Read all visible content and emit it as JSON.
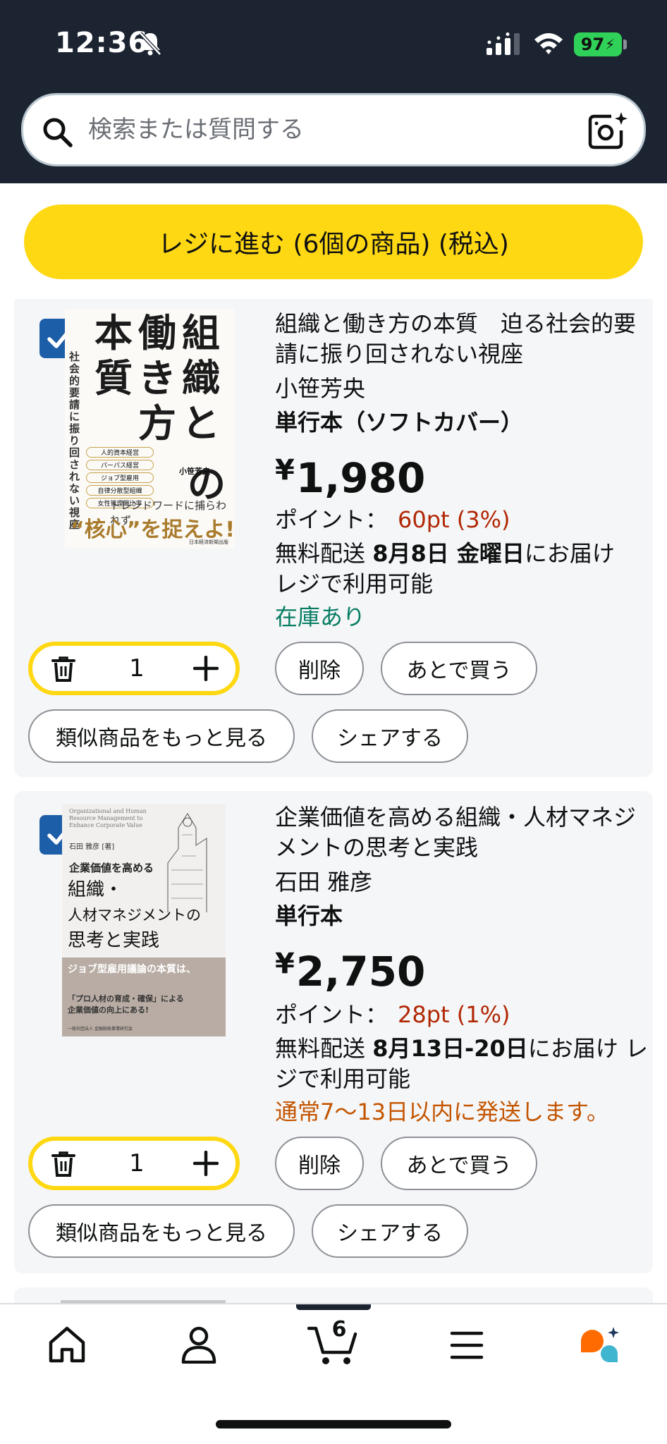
{
  "status_bar": {
    "time": "12:36",
    "battery": "97"
  },
  "search": {
    "placeholder": "検索または質問する"
  },
  "checkout": {
    "label": "レジに進む (6個の商品) (税込)"
  },
  "products": [
    {
      "title": "組織と働き方の本質　迫る社会的要請に振り回されない視座",
      "author": "小笹芳央",
      "format": "単行本（ソフトカバー）",
      "price_symbol": "¥",
      "price": "1,980",
      "points_label": "ポイント：",
      "points_value": "60pt (3%)",
      "delivery_prefix": "無料配送",
      "delivery_date": "8月8日 金曜日",
      "delivery_suffix": "にお届け",
      "delivery_note": "レジで利用可能",
      "availability": "在庫あり",
      "quantity": "1",
      "cover": {
        "title_lines": [
          "組",
          "織",
          "と",
          "働",
          "き",
          "方",
          "の",
          "本",
          "質"
        ],
        "side_text": "社会的要請に振り回されない視座",
        "author": "小笹芳央",
        "tagline": "トレンドワードに捕らわれず",
        "catch": "“核心”を捉えよ!",
        "box_items": [
          "人的資本経営",
          "パーパス経営",
          "ジョブ型雇用",
          "自律分散型組織",
          "女性管理職比率"
        ],
        "publisher": "日本経済新聞出版"
      }
    },
    {
      "title": "企業価値を高める組織・人材マネジメントの思考と実践",
      "author": "石田 雅彦",
      "format": "単行本",
      "price_symbol": "¥",
      "price": "2,750",
      "points_label": "ポイント：",
      "points_value": "28pt (1%)",
      "delivery_prefix": "無料配送",
      "delivery_date": "8月13日-20日",
      "delivery_suffix": "にお届け",
      "delivery_note": "レジで利用可能",
      "availability": "通常7～13日以内に発送します。",
      "quantity": "1",
      "cover": {
        "en_title": "Organizational and Human Resource Management to Enhance Corporate Value",
        "author": "石田 雅彦 [著]",
        "subtitle": "企業価値を高める",
        "title_lines": [
          "組織・",
          "人材マネジメントの",
          "思考と実践"
        ],
        "band1": "ジョブ型雇用議論の本質は、",
        "band2": "「プロ人材の育成・確保」による",
        "band3": "企業価値の向上にある!",
        "publisher": "一般社団法人 金融財政事情研究会"
      }
    }
  ],
  "actions": {
    "delete": "削除",
    "save_later": "あとで買う",
    "similar": "類似商品をもっと見る",
    "share": "シェアする"
  },
  "bottom_nav": {
    "cart_count": "6"
  },
  "colors": {
    "accent_yellow": "#ffd814",
    "header_bg": "#1c2431",
    "price_red": "#b12704",
    "in_stock_green": "#067d62",
    "ship_orange": "#c45500",
    "check_blue": "#1d5ea8"
  }
}
